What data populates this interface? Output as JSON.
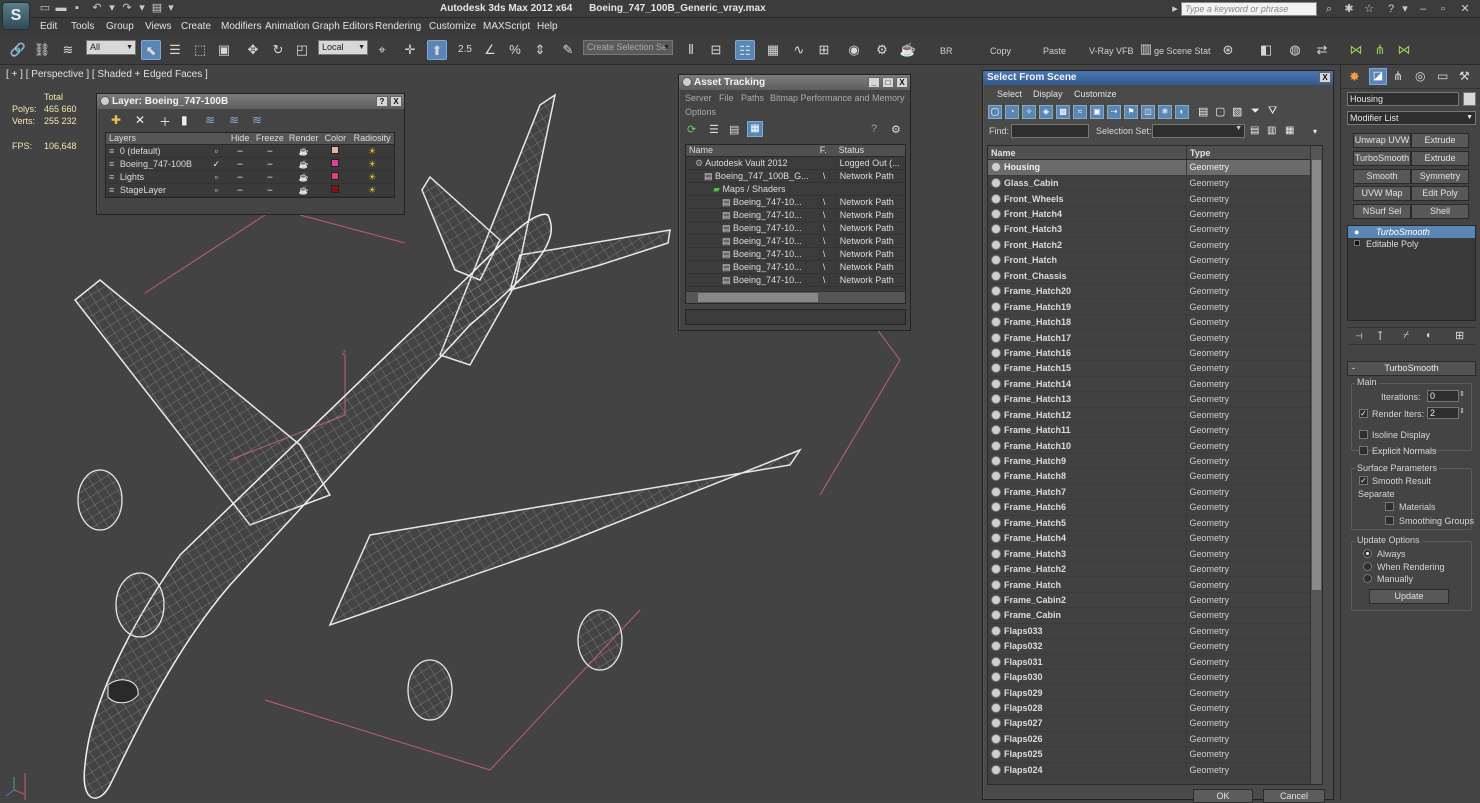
{
  "titlebar": {
    "app_title": "Autodesk 3ds Max  2012 x64",
    "file_name": "Boeing_747_100B_Generic_vray.max",
    "search_placeholder": "Type a keyword or phrase",
    "app_logo": "3ds-max-logo"
  },
  "menu": [
    "Edit",
    "Tools",
    "Group",
    "Views",
    "Create",
    "Modifiers",
    "Animation",
    "Graph Editors",
    "Rendering",
    "Customize",
    "MAXScript",
    "Help"
  ],
  "toolbar": {
    "filter_value": "All",
    "coord_value": "Local",
    "snap_value": "2.5",
    "selection_set_placeholder": "Create Selection Se",
    "text_buttons": [
      "BR",
      "Copy",
      "Paste",
      "V-Ray VFB",
      "ge Scene Stat"
    ]
  },
  "viewport": {
    "label": "[ + ] [ Perspective ] [ Shaded + Edged Faces ]",
    "stats": {
      "total_label": "Total",
      "polys_label": "Polys:",
      "polys_value": "465 660",
      "verts_label": "Verts:",
      "verts_value": "255 232",
      "fps_label": "FPS:",
      "fps_value": "106,648"
    },
    "axis_label": "z"
  },
  "layer_panel": {
    "title": "Layer: Boeing_747-100B",
    "help_btn": "?",
    "close_btn": "X",
    "columns": [
      "Layers",
      "Hide",
      "Freeze",
      "Render",
      "Color",
      "Radiosity"
    ],
    "rows": [
      {
        "name": "0 (default)",
        "color": "#e0b8a0",
        "current": false
      },
      {
        "name": "Boeing_747-100B",
        "color": "#e040a0",
        "current": true
      },
      {
        "name": "Lights",
        "color": "#e0407a",
        "current": false
      },
      {
        "name": "StageLayer",
        "color": "#8a1010",
        "current": false
      }
    ]
  },
  "asset_panel": {
    "title": "Asset Tracking",
    "menu": [
      "Server",
      "File",
      "Paths",
      "Bitmap Performance and Memory",
      "Options"
    ],
    "columns": [
      "Name",
      "F.",
      "Status"
    ],
    "rows": [
      {
        "name": "Autodesk Vault 2012",
        "f": "",
        "status": "Logged Out (...",
        "indent": 1
      },
      {
        "name": "Boeing_747_100B_G...",
        "f": "\\",
        "status": "Network Path",
        "indent": 2
      },
      {
        "name": "Maps / Shaders",
        "f": "",
        "status": "",
        "indent": 3
      },
      {
        "name": "Boeing_747-10...",
        "f": "\\",
        "status": "Network Path",
        "indent": 4
      },
      {
        "name": "Boeing_747-10...",
        "f": "\\",
        "status": "Network Path",
        "indent": 4
      },
      {
        "name": "Boeing_747-10...",
        "f": "\\",
        "status": "Network Path",
        "indent": 4
      },
      {
        "name": "Boeing_747-10...",
        "f": "\\",
        "status": "Network Path",
        "indent": 4
      },
      {
        "name": "Boeing_747-10...",
        "f": "\\",
        "status": "Network Path",
        "indent": 4
      },
      {
        "name": "Boeing_747-10...",
        "f": "\\",
        "status": "Network Path",
        "indent": 4
      },
      {
        "name": "Boeing_747-10...",
        "f": "\\",
        "status": "Network Path",
        "indent": 4
      }
    ]
  },
  "select_panel": {
    "title": "Select From Scene",
    "menu": [
      "Select",
      "Display",
      "Customize"
    ],
    "find_label": "Find:",
    "selection_set_label": "Selection Set:",
    "columns": [
      "Name",
      "Type"
    ],
    "rows": [
      [
        "Housing",
        "Geometry"
      ],
      [
        "Glass_Cabin",
        "Geometry"
      ],
      [
        "Front_Wheels",
        "Geometry"
      ],
      [
        "Front_Hatch4",
        "Geometry"
      ],
      [
        "Front_Hatch3",
        "Geometry"
      ],
      [
        "Front_Hatch2",
        "Geometry"
      ],
      [
        "Front_Hatch",
        "Geometry"
      ],
      [
        "Front_Chassis",
        "Geometry"
      ],
      [
        "Frame_Hatch20",
        "Geometry"
      ],
      [
        "Frame_Hatch19",
        "Geometry"
      ],
      [
        "Frame_Hatch18",
        "Geometry"
      ],
      [
        "Frame_Hatch17",
        "Geometry"
      ],
      [
        "Frame_Hatch16",
        "Geometry"
      ],
      [
        "Frame_Hatch15",
        "Geometry"
      ],
      [
        "Frame_Hatch14",
        "Geometry"
      ],
      [
        "Frame_Hatch13",
        "Geometry"
      ],
      [
        "Frame_Hatch12",
        "Geometry"
      ],
      [
        "Frame_Hatch11",
        "Geometry"
      ],
      [
        "Frame_Hatch10",
        "Geometry"
      ],
      [
        "Frame_Hatch9",
        "Geometry"
      ],
      [
        "Frame_Hatch8",
        "Geometry"
      ],
      [
        "Frame_Hatch7",
        "Geometry"
      ],
      [
        "Frame_Hatch6",
        "Geometry"
      ],
      [
        "Frame_Hatch5",
        "Geometry"
      ],
      [
        "Frame_Hatch4",
        "Geometry"
      ],
      [
        "Frame_Hatch3",
        "Geometry"
      ],
      [
        "Frame_Hatch2",
        "Geometry"
      ],
      [
        "Frame_Hatch",
        "Geometry"
      ],
      [
        "Frame_Cabin2",
        "Geometry"
      ],
      [
        "Frame_Cabin",
        "Geometry"
      ],
      [
        "Flaps033",
        "Geometry"
      ],
      [
        "Flaps032",
        "Geometry"
      ],
      [
        "Flaps031",
        "Geometry"
      ],
      [
        "Flaps030",
        "Geometry"
      ],
      [
        "Flaps029",
        "Geometry"
      ],
      [
        "Flaps028",
        "Geometry"
      ],
      [
        "Flaps027",
        "Geometry"
      ],
      [
        "Flaps026",
        "Geometry"
      ],
      [
        "Flaps025",
        "Geometry"
      ],
      [
        "Flaps024",
        "Geometry"
      ]
    ],
    "ok_label": "OK",
    "cancel_label": "Cancel"
  },
  "command_panel": {
    "object_name": "Housing",
    "modifier_list": "Modifier List",
    "mod_buttons": [
      "Unwrap UVW",
      "Extrude",
      "TurboSmooth",
      "Extrude",
      "Smooth",
      "Symmetry",
      "UVW Map",
      "Edit Poly",
      "NSurf Sel",
      "Shell"
    ],
    "stack": [
      "TurboSmooth",
      "Editable Poly"
    ],
    "rollout_title": "TurboSmooth",
    "main_label": "Main",
    "iterations_label": "Iterations:",
    "iterations_value": "0",
    "render_iters_label": "Render Iters:",
    "render_iters_value": "2",
    "isoline_label": "Isoline Display",
    "explicit_label": "Explicit Normals",
    "surface_label": "Surface Parameters",
    "smooth_result_label": "Smooth Result",
    "separate_label": "Separate",
    "materials_label": "Materials",
    "smoothing_groups_label": "Smoothing Groups",
    "update_options_label": "Update Options",
    "always_label": "Always",
    "when_rendering_label": "When Rendering",
    "manually_label": "Manually",
    "update_button": "Update"
  }
}
